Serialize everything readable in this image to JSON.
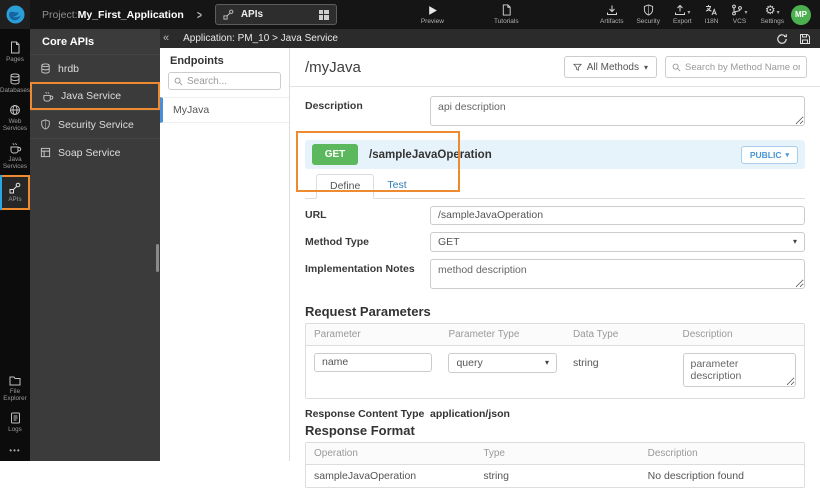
{
  "colors": {
    "accent_orange": "#ee8a2f",
    "get_badge_green": "#5cb85c",
    "avatar_green": "#4caf50",
    "selected_blue": "#4a90d9",
    "method_header_bg": "#e7f3fb"
  },
  "icons": {
    "chevron_right": ">",
    "collapse_left": "«",
    "caret_down": "▾",
    "more_dots": "•••",
    "gear": "⚙"
  },
  "topbar": {
    "project_label": "Project:",
    "project_name": "My_First_Application",
    "tab_label": "APIs",
    "preview_label": "Preview",
    "tutorials_label": "Tutorials",
    "tools": [
      {
        "label": "Artifacts",
        "icon": "download-icon"
      },
      {
        "label": "Security",
        "icon": "shield-icon"
      },
      {
        "label": "Export",
        "icon": "upload-icon"
      },
      {
        "label": "I18N",
        "icon": "translate-icon"
      },
      {
        "label": "VCS",
        "icon": "branch-icon"
      },
      {
        "label": "Settings",
        "icon": "gear-icon"
      }
    ],
    "avatar_initials": "MP"
  },
  "sidebar": {
    "items": [
      {
        "label": "Pages",
        "icon": "page-icon"
      },
      {
        "label": "Databases",
        "icon": "database-icon"
      },
      {
        "label": "Web Services",
        "icon": "globe-icon"
      },
      {
        "label": "Java Services",
        "icon": "coffee-icon"
      },
      {
        "label": "APIs",
        "icon": "api-icon",
        "selected": true
      }
    ],
    "bottom_items": [
      {
        "label": "File Explorer",
        "icon": "folder-icon"
      },
      {
        "label": "Logs",
        "icon": "logs-icon"
      }
    ]
  },
  "core_apis": {
    "title": "Core APIs",
    "items": [
      {
        "label": "hrdb",
        "icon": "database-icon"
      },
      {
        "label": "Java Service",
        "icon": "coffee-icon",
        "highlighted": true
      },
      {
        "label": "Security Service",
        "icon": "shield-icon"
      },
      {
        "label": "Soap Service",
        "icon": "soap-icon"
      }
    ]
  },
  "breadcrumb": {
    "text": "Application: PM_10 > Java Service"
  },
  "endpoints": {
    "title": "Endpoints",
    "search_placeholder": "Search...",
    "items": [
      {
        "label": "MyJava",
        "selected": true
      }
    ]
  },
  "main": {
    "title": "/myJava",
    "filter_label": "All Methods",
    "search_placeholder": "Search by Method Name or URL...",
    "description_label": "Description",
    "description_value": "api description",
    "method": {
      "verb": "GET",
      "path": "/sampleJavaOperation",
      "visibility_label": "PUBLIC",
      "tabs": [
        {
          "label": "Define",
          "active": true
        },
        {
          "label": "Test",
          "active": false
        }
      ],
      "url_label": "URL",
      "url_value": "/sampleJavaOperation",
      "method_type_label": "Method Type",
      "method_type_value": "GET",
      "implementation_notes_label": "Implementation Notes",
      "implementation_notes_value": "method description",
      "request_parameters": {
        "title": "Request Parameters",
        "headers": [
          "Parameter",
          "Parameter Type",
          "Data Type",
          "Description"
        ],
        "row": {
          "parameter": "name",
          "parameter_type": "query",
          "data_type": "string",
          "description": "parameter description"
        }
      },
      "response_content_type_label": "Response Content Type",
      "response_content_type_value": "application/json",
      "response_format": {
        "title": "Response Format",
        "headers": [
          "Operation",
          "Type",
          "Description"
        ],
        "rows": [
          [
            "sampleJavaOperation",
            "string",
            "No description found"
          ]
        ]
      }
    }
  }
}
